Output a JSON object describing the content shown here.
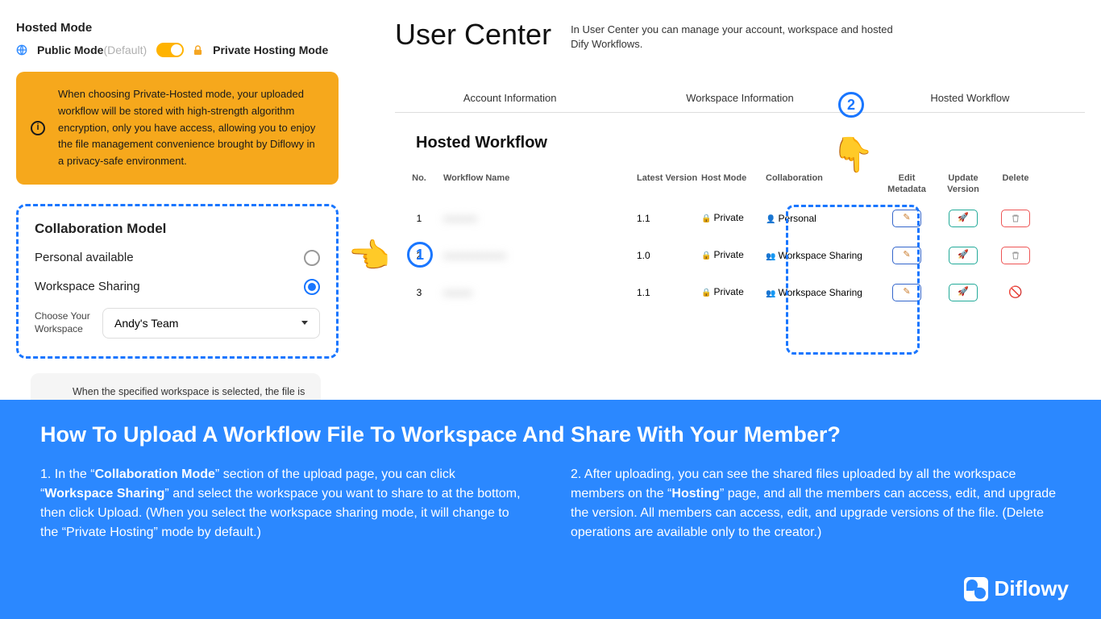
{
  "left": {
    "hosted_mode_title": "Hosted Mode",
    "public_mode": "Public Mode",
    "default": "(Default)",
    "private_mode": "Private Hosting Mode",
    "info": "When choosing Private-Hosted mode, your uploaded workflow will be stored with high-strength algorithm encryption, only you have access, allowing you to enjoy the file management convenience brought by Diflowy in a privacy-safe environment.",
    "collab_title": "Collaboration Model",
    "opt_personal": "Personal available",
    "opt_ws": "Workspace Sharing",
    "choose_ws": "Choose Your Workspace",
    "ws_value": "Andy's Team",
    "note": "When the specified workspace is selected, the file is accessible to all workspace members while the hosted mode defaults to Private-Hosting mode"
  },
  "uc": {
    "title": "User Center",
    "desc": "In User Center you can manage your account, workspace and hosted Dify Workflows.",
    "tabs": [
      "Account Information",
      "Workspace Information",
      "Hosted Workflow"
    ],
    "hosted_title": "Hosted Workflow",
    "head": {
      "no": "No.",
      "name": "Workflow Name",
      "ver": "Latest Version",
      "mode": "Host Mode",
      "collab": "Collaboration",
      "edit": "Edit Metadata",
      "upd": "Update Version",
      "del": "Delete"
    },
    "rows": [
      {
        "no": "1",
        "name": "xxxxxxx",
        "ver": "1.1",
        "mode": "Private",
        "collab": "Personal",
        "collab_icon": "user",
        "can_delete": true
      },
      {
        "no": "2",
        "name": "xxxxxxxxxxxxx",
        "ver": "1.0",
        "mode": "Private",
        "collab": "Workspace Sharing",
        "collab_icon": "users",
        "can_delete": true
      },
      {
        "no": "3",
        "name": "xxxxxx",
        "ver": "1.1",
        "mode": "Private",
        "collab": "Workspace Sharing",
        "collab_icon": "users",
        "can_delete": false
      }
    ]
  },
  "banner": {
    "title": "How To Upload A Workflow File To Workspace And Share With Your Member?",
    "step1_a": "1. In the “",
    "step1_b": "Collaboration Mode",
    "step1_c": "” section of the upload page, you can click “",
    "step1_d": "Workspace Sharing",
    "step1_e": "” and select the workspace you want to share to at the bottom, then click Upload. (When you select the workspace sharing mode, it will change to the “Private Hosting” mode by default.)",
    "step2_a": "2. After uploading, you can see the shared files uploaded by all the workspace members on the “",
    "step2_b": "Hosting",
    "step2_c": "” page, and all the members can access, edit, and upgrade the version. All members can access, edit, and upgrade versions of the file. (Delete operations are available only to the creator.)",
    "logo": "Diflowy"
  },
  "markers": {
    "one": "1",
    "two": "2"
  }
}
